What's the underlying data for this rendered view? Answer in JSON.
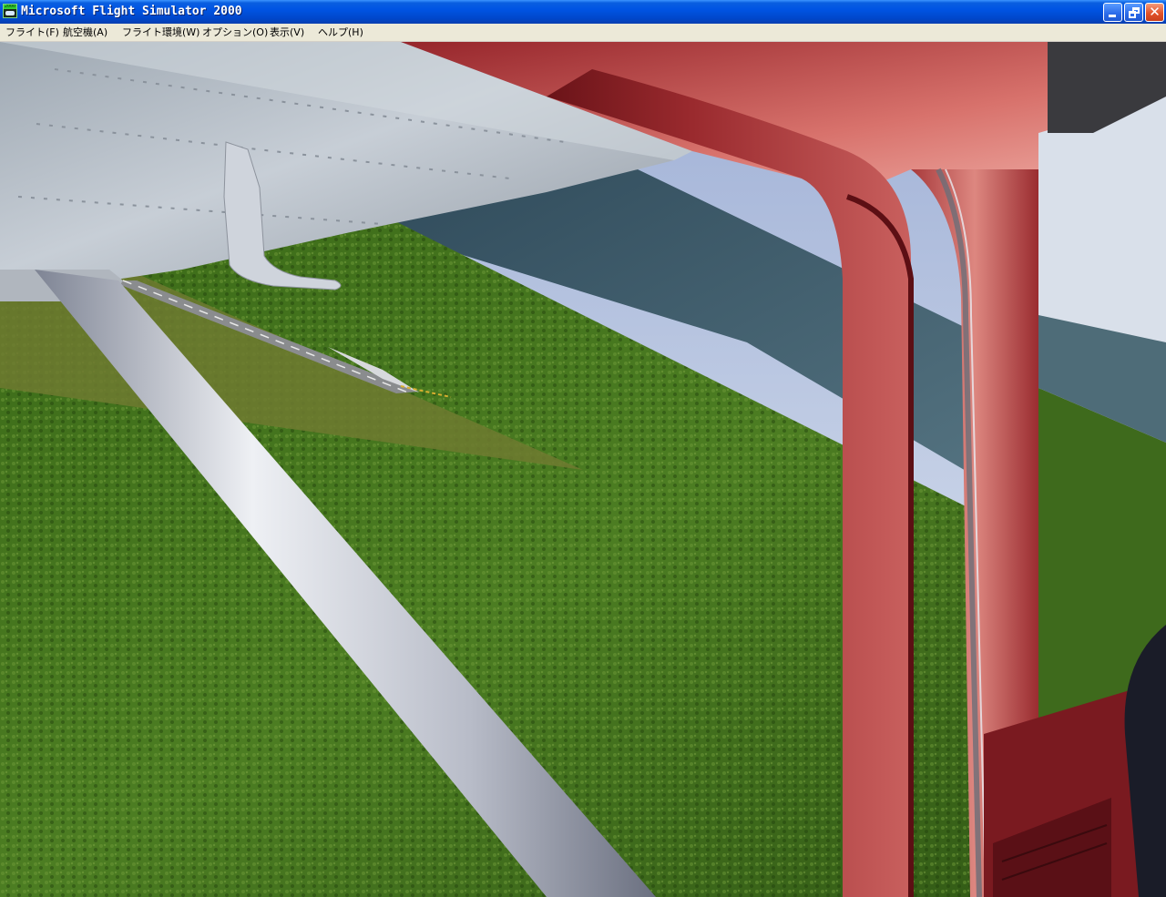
{
  "window": {
    "title": "Microsoft Flight Simulator 2000",
    "icon": "fs2000-app-icon",
    "icon_text": "2000",
    "buttons": {
      "minimize": "minimize-icon",
      "restore": "restore-icon",
      "close": "close-icon"
    }
  },
  "menu": {
    "items": [
      {
        "label": "フライト(F)"
      },
      {
        "label": "航空機(A)"
      },
      {
        "label": "フライト環境(W)"
      },
      {
        "label": "オプション(O)"
      },
      {
        "label": "表示(V)"
      },
      {
        "label": "ヘルプ(H)"
      }
    ]
  },
  "scene": {
    "view": "cockpit side view from high-wing aircraft",
    "colors": {
      "frame_red": "#8c1e26",
      "grass": "#3f6b1c",
      "sky": "#cdd8e8",
      "sea": "#3f5d6e",
      "wing": "#b8c0c8",
      "strut": "#d6d8de"
    }
  }
}
